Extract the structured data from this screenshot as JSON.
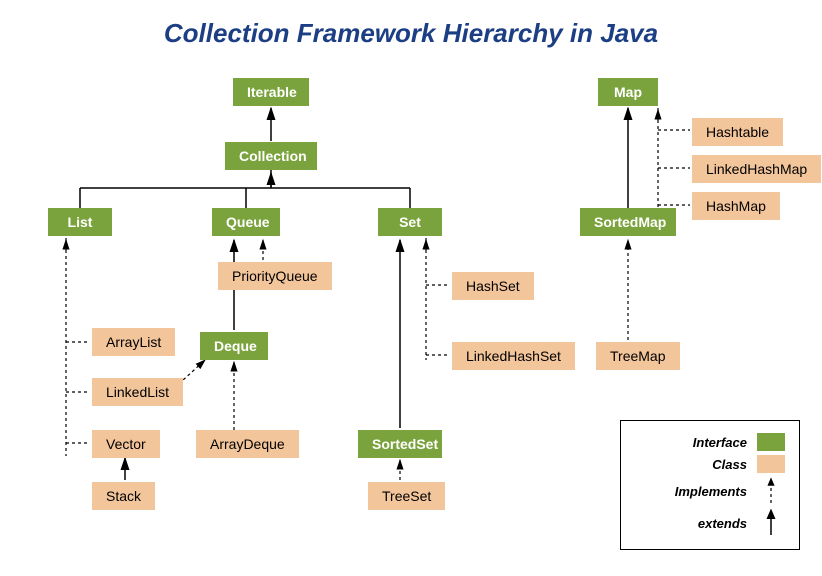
{
  "title": "Collection Framework Hierarchy in Java",
  "legend": {
    "interface": "Interface",
    "class": "Class",
    "implements": "Implements",
    "extends": "extends"
  },
  "nodes": {
    "iterable": "Iterable",
    "collection": "Collection",
    "list": "List",
    "queue": "Queue",
    "set": "Set",
    "deque": "Deque",
    "sortedset": "SortedSet",
    "map": "Map",
    "sortedmap": "SortedMap",
    "arraylist": "ArrayList",
    "linkedlist": "LinkedList",
    "vector": "Vector",
    "stack": "Stack",
    "priorityqueue": "PriorityQueue",
    "arraydeque": "ArrayDeque",
    "hashset": "HashSet",
    "linkedhashset": "LinkedHashSet",
    "treeset": "TreeSet",
    "hashtable": "Hashtable",
    "linkedhashmap": "LinkedHashMap",
    "hashmap": "HashMap",
    "treemap": "TreeMap"
  }
}
